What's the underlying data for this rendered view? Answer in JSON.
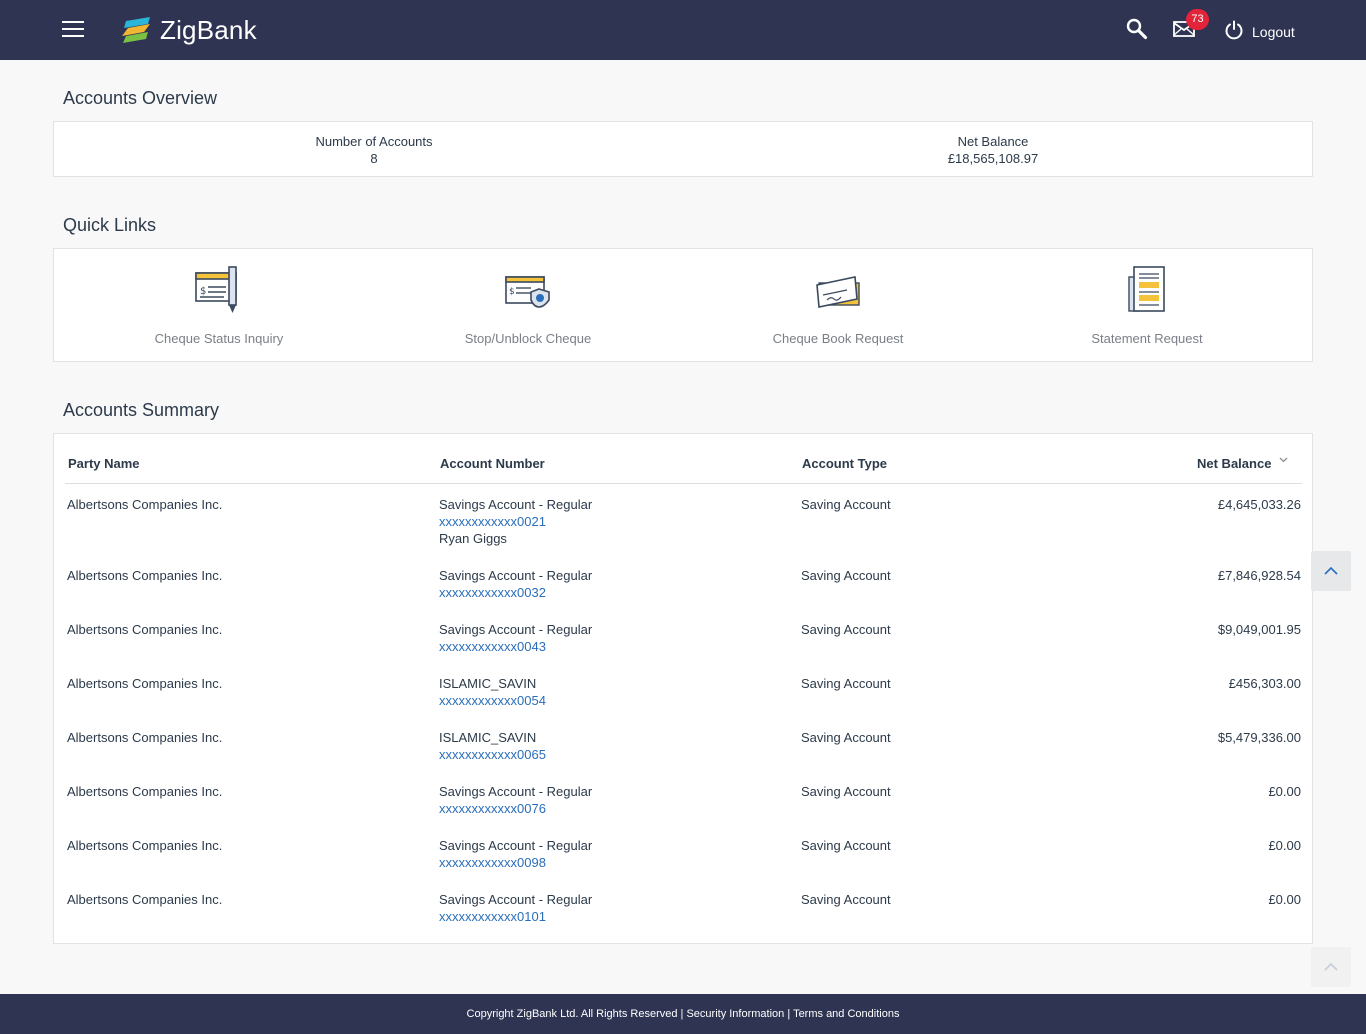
{
  "header": {
    "brand": "ZigBank",
    "mail_count": "73",
    "logout_label": "Logout"
  },
  "overview": {
    "title": "Accounts Overview",
    "accounts_label": "Number of Accounts",
    "accounts_value": "8",
    "balance_label": "Net Balance",
    "balance_value": "£18,565,108.97"
  },
  "quick_links": {
    "title": "Quick Links",
    "items": [
      {
        "label": "Cheque Status Inquiry",
        "icon": "cheque-status-icon"
      },
      {
        "label": "Stop/Unblock Cheque",
        "icon": "stop-cheque-icon"
      },
      {
        "label": "Cheque Book Request",
        "icon": "cheque-book-icon"
      },
      {
        "label": "Statement Request",
        "icon": "statement-icon"
      }
    ]
  },
  "summary": {
    "title": "Accounts Summary",
    "columns": [
      "Party Name",
      "Account Number",
      "Account Type",
      "Net Balance"
    ],
    "rows": [
      {
        "party": "Albertsons Companies Inc.",
        "product": "Savings Account - Regular",
        "number": "xxxxxxxxxxxx0021",
        "holder": "Ryan Giggs",
        "type": "Saving Account",
        "balance": "£4,645,033.26"
      },
      {
        "party": "Albertsons Companies Inc.",
        "product": "Savings Account - Regular",
        "number": "xxxxxxxxxxxx0032",
        "holder": "",
        "type": "Saving Account",
        "balance": "£7,846,928.54"
      },
      {
        "party": "Albertsons Companies Inc.",
        "product": "Savings Account - Regular",
        "number": "xxxxxxxxxxxx0043",
        "holder": "",
        "type": "Saving Account",
        "balance": "$9,049,001.95"
      },
      {
        "party": "Albertsons Companies Inc.",
        "product": "ISLAMIC_SAVIN",
        "number": "xxxxxxxxxxxx0054",
        "holder": "",
        "type": "Saving Account",
        "balance": "£456,303.00"
      },
      {
        "party": "Albertsons Companies Inc.",
        "product": "ISLAMIC_SAVIN",
        "number": "xxxxxxxxxxxx0065",
        "holder": "",
        "type": "Saving Account",
        "balance": "$5,479,336.00"
      },
      {
        "party": "Albertsons Companies Inc.",
        "product": "Savings Account - Regular",
        "number": "xxxxxxxxxxxx0076",
        "holder": "",
        "type": "Saving Account",
        "balance": "£0.00"
      },
      {
        "party": "Albertsons Companies Inc.",
        "product": "Savings Account - Regular",
        "number": "xxxxxxxxxxxx0098",
        "holder": "",
        "type": "Saving Account",
        "balance": "£0.00"
      },
      {
        "party": "Albertsons Companies Inc.",
        "product": "Savings Account - Regular",
        "number": "xxxxxxxxxxxx0101",
        "holder": "",
        "type": "Saving Account",
        "balance": "£0.00"
      }
    ]
  },
  "footer": {
    "copyright": "Copyright ZigBank Ltd. All Rights Reserved",
    "security": "Security Information",
    "terms": "Terms and Conditions"
  },
  "colors": {
    "header_bg": "#2e3452",
    "link": "#2a6ebb",
    "badge": "#e2243a"
  }
}
